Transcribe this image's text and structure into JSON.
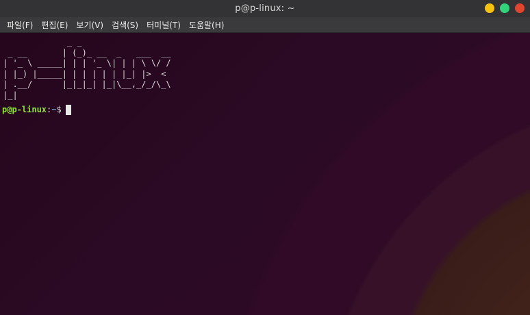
{
  "window": {
    "title": "p@p-linux: ~",
    "buttons": [
      {
        "name": "minimize",
        "color": "#f5c211"
      },
      {
        "name": "maximize",
        "color": "#33d17a"
      },
      {
        "name": "close",
        "color": "#e0452f"
      }
    ]
  },
  "menu": {
    "items": [
      "파일(F)",
      "편집(E)",
      "보기(V)",
      "검색(S)",
      "터미널(T)",
      "도움말(H)"
    ]
  },
  "terminal": {
    "ascii_art": "             _ _\n _ __       | (_)_ __  _   ___  __\n| '_ \\ _____| | | '_ \\| | | \\ \\/ /\n| |_) |_____| | | | | | |_| |>  <\n| .__/      |_|_|_| |_|\\__,_/_/\\_\\\n|_|",
    "prompt": {
      "user_host": "p@p-linux",
      "separator": ":",
      "path": "~",
      "symbol": "$"
    }
  }
}
